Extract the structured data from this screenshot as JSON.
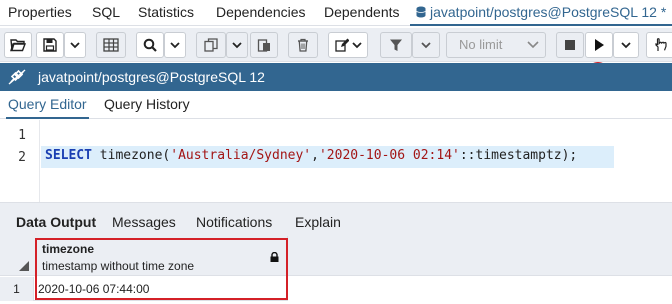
{
  "tabs": [
    {
      "label": "Properties"
    },
    {
      "label": "SQL"
    },
    {
      "label": "Statistics"
    },
    {
      "label": "Dependencies"
    },
    {
      "label": "Dependents"
    },
    {
      "label": "javatpoint/postgres@PostgreSQL 12 *"
    }
  ],
  "toolbar": {
    "limit_placeholder": "No limit"
  },
  "connection": {
    "label": "javatpoint/postgres@PostgreSQL 12"
  },
  "editor_tabs": [
    {
      "label": "Query Editor"
    },
    {
      "label": "Query History"
    }
  ],
  "editor": {
    "line_numbers": [
      "1",
      "2"
    ],
    "code": {
      "keyword": "SELECT",
      "func": " timezone(",
      "arg1": "'Australia/Sydney'",
      "comma": ",",
      "arg2": "'2020-10-06 02:14'",
      "cast": "::timestamptz);"
    }
  },
  "output_tabs": [
    {
      "label": "Data Output"
    },
    {
      "label": "Messages"
    },
    {
      "label": "Notifications"
    },
    {
      "label": "Explain"
    }
  ],
  "grid": {
    "columns": [
      {
        "name": "timezone",
        "type": "timestamp without time zone"
      }
    ],
    "rows": [
      {
        "num": "1",
        "cells": [
          "2020-10-06 07:44:00"
        ]
      }
    ]
  },
  "colors": {
    "accent": "#326690",
    "highlight": "#d42027",
    "toolbar_bg": "#ebeef3"
  }
}
